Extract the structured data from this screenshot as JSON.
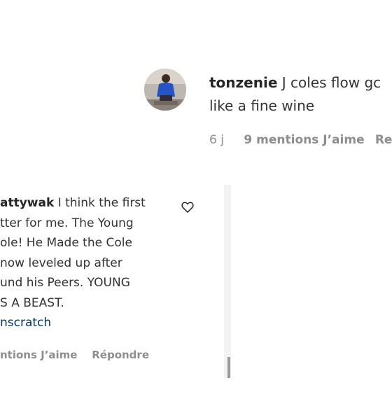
{
  "comment_right": {
    "username": "tonzenie",
    "text_line1": "J coles flow gc",
    "text_line2": "like a fine wine",
    "time": "6 j",
    "likes": "9 mentions J’aime",
    "reply": "Re"
  },
  "comment_left": {
    "username_fragment": "attywak",
    "line1": "I think the first",
    "line2": "tter for me. The Young",
    "line3": "ole! He Made the Cole",
    "line4": "now leveled up after",
    "line5": "und his Peers. YOUNG",
    "line6": "S A BEAST.",
    "mention": "nscratch",
    "likes": "ntions J’aime",
    "reply": "Répondre"
  },
  "icons": {
    "like": "heart-icon"
  },
  "colors": {
    "text": "#262626",
    "muted": "#8e8e8e",
    "link": "#00376b"
  }
}
